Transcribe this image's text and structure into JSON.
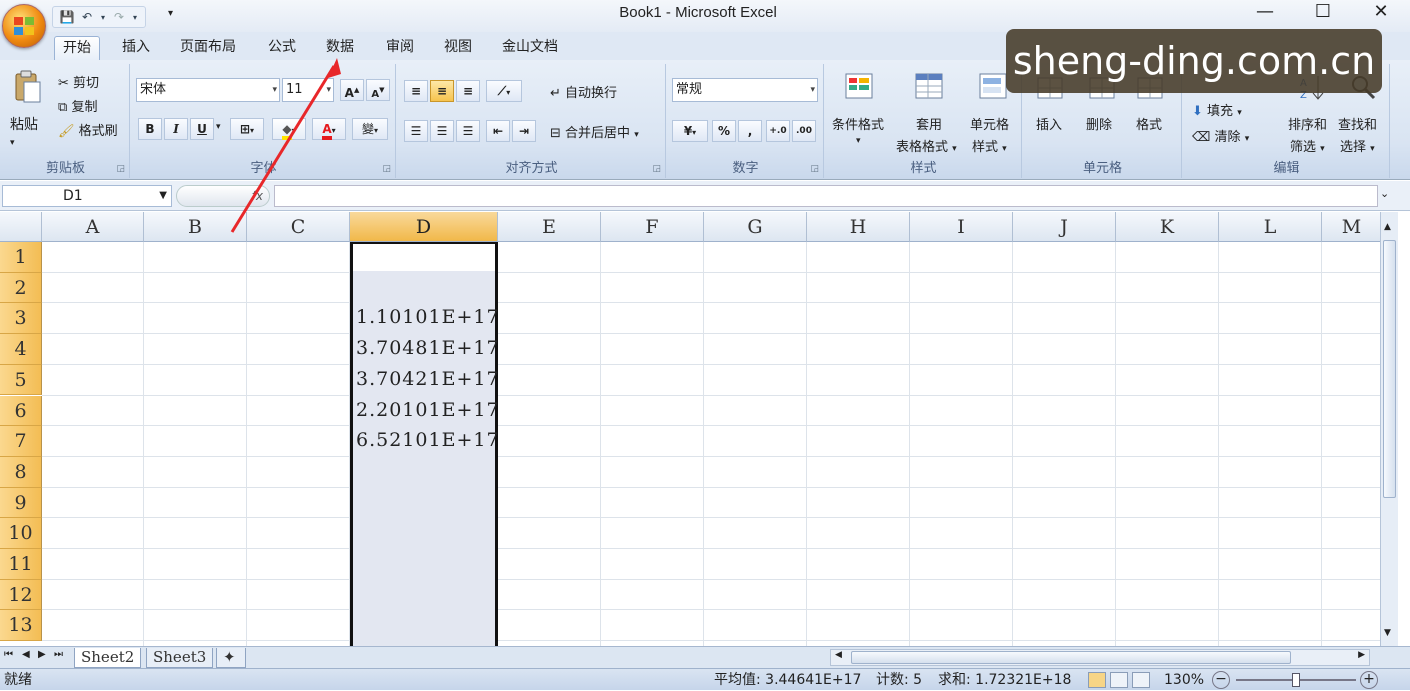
{
  "window": {
    "title": "Book1 - Microsoft Excel",
    "minimize": "—",
    "maximize": "☐",
    "close": "✕"
  },
  "ribbon_tabs": [
    "开始",
    "插入",
    "页面布局",
    "公式",
    "数据",
    "审阅",
    "视图",
    "金山文档"
  ],
  "clipboard": {
    "paste": "粘贴",
    "cut": "剪切",
    "copy": "复制",
    "format_painter": "格式刷",
    "label": "剪贴板"
  },
  "font": {
    "name": "宋体",
    "size": "11",
    "label": "字体",
    "bold": "B",
    "italic": "I",
    "underline": "U",
    "grow": "A",
    "shrink": "A",
    "font_color": "A",
    "phonetic": "變"
  },
  "alignment": {
    "wrap": "自动换行",
    "merge": "合并后居中",
    "label": "对齐方式"
  },
  "number": {
    "format": "常规",
    "label": "数字",
    "percent": "%",
    "comma": ","
  },
  "styles": {
    "conditional": "条件格式",
    "table_1": "套用",
    "table_2": "表格格式",
    "cell_styles_1": "单元格",
    "cell_styles_2": "样式",
    "label": "样式"
  },
  "cells": {
    "insert": "插入",
    "delete": "删除",
    "format": "格式",
    "label": "单元格"
  },
  "editing": {
    "fill": "填充",
    "clear": "清除",
    "sort_1": "排序和",
    "sort_2": "筛选",
    "find_1": "查找和",
    "find_2": "选择",
    "label": "编辑"
  },
  "formula_bar": {
    "name_box": "D1",
    "fx": "fx",
    "formula": ""
  },
  "columns": [
    "A",
    "B",
    "C",
    "D",
    "E",
    "F",
    "G",
    "H",
    "I",
    "J",
    "K",
    "L",
    "M"
  ],
  "selected_column": "D",
  "rows": [
    "1",
    "2",
    "3",
    "4",
    "5",
    "6",
    "7",
    "8",
    "9",
    "10",
    "11",
    "12",
    "13"
  ],
  "cell_values": [
    {
      "ref": "D3",
      "value": "1.10101E+17"
    },
    {
      "ref": "D4",
      "value": "3.70481E+17"
    },
    {
      "ref": "D5",
      "value": "3.70421E+17"
    },
    {
      "ref": "D6",
      "value": "2.20101E+17"
    },
    {
      "ref": "D7",
      "value": "6.52101E+17"
    }
  ],
  "sheets": [
    "Sheet2",
    "Sheet3"
  ],
  "status": {
    "ready": "就绪",
    "average": "平均值: 3.44641E+17",
    "count": "计数: 5",
    "sum": "求和: 1.72321E+18",
    "zoom": "130%"
  },
  "watermark": "sheng-ding.com.cn",
  "colors": {
    "accent": "#e8272a",
    "row_header": "#f6c76a",
    "selected_header": "#f2bc52"
  }
}
